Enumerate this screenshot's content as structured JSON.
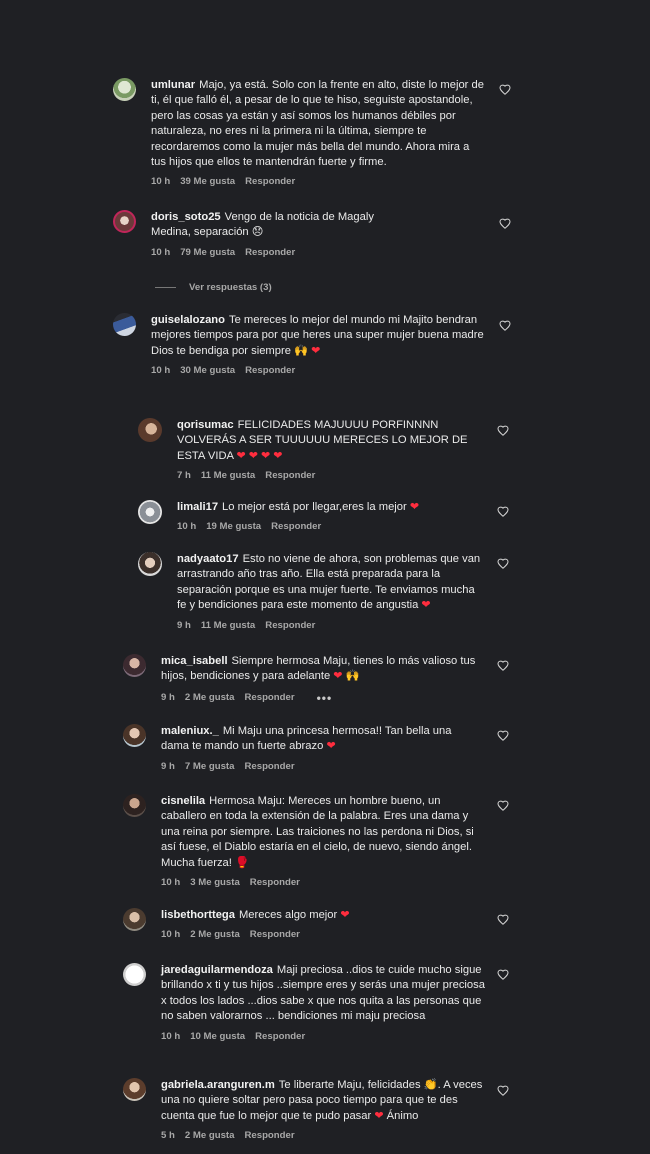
{
  "colors": {
    "background": "#1f2024",
    "text": "#eaeaea",
    "meta": "#a8a8a8",
    "heart": "#ff2d3e"
  },
  "comments": [
    {
      "username": "umlunar",
      "text": "Majo, ya está. Solo con la frente en alto, diste lo mejor de ti, él que falló él, a pesar de lo que te hiso, seguiste apostandole, pero las cosas ya están y así somos los humanos débiles por naturaleza, no eres ni la primera ni la última, siempre te recordaremos como la mujer más bella del mundo. Ahora mira a tus hijos que ellos te mantendrán fuerte y firme.",
      "time": "10 h",
      "likes": "39 Me gusta",
      "reply": "Responder"
    },
    {
      "username": "doris_soto25",
      "text": "Vengo de la noticia de Magaly Medina, separación 😞",
      "time": "10 h",
      "likes": "79 Me gusta",
      "reply": "Responder"
    },
    {
      "username": "guiselalozano",
      "text": "Te mereces lo mejor del mundo mi Majito bendran mejores tiempos para por que heres una super mujer buena madre Dios te bendiga por siempre 🙌",
      "heart": "❤",
      "time": "10 h",
      "likes": "30 Me gusta",
      "reply": "Responder"
    },
    {
      "username": "qorisumac",
      "text": "FELICIDADES MAJUUUU PORFINNNN VOLVERÁS A SER TUUUUUU MERECES LO MEJOR DE ESTA VIDA",
      "heart": "❤ ❤ ❤ ❤",
      "time": "7 h",
      "likes": "11 Me gusta",
      "reply": "Responder"
    },
    {
      "username": "limali17",
      "text": "Lo mejor está por llegar,eres la mejor",
      "heart": "❤",
      "time": "10 h",
      "likes": "19 Me gusta",
      "reply": "Responder"
    },
    {
      "username": "nadyaato17",
      "text": "Esto no viene de ahora, son problemas que van arrastrando año tras año. Ella está preparada para la separación porque es una mujer fuerte. Te enviamos mucha fe y bendiciones para este momento de angustia",
      "heart": "❤",
      "time": "9 h",
      "likes": "11 Me gusta",
      "reply": "Responder"
    },
    {
      "username": "mica_isabell",
      "text": "Siempre hermosa Maju, tienes lo más valioso tus hijos, bendiciones y para adelante",
      "heart": "❤",
      "tail": "🙌",
      "time": "9 h",
      "likes": "2 Me gusta",
      "reply": "Responder",
      "more": "•••"
    },
    {
      "username": "maleniux._",
      "text": "Mi Maju una princesa hermosa!! Tan bella una dama te mando un fuerte abrazo",
      "heart": "❤",
      "time": "9 h",
      "likes": "7 Me gusta",
      "reply": "Responder"
    },
    {
      "username": "cisnelila",
      "text": "Hermosa Maju: Mereces un hombre bueno, un caballero en toda la extensión de la palabra. Eres una dama y una reina por siempre. Las traiciones no las perdona ni Dios, si así fuese, el Diablo estaría en el cielo, de nuevo, siendo ángel. Mucha fuerza! 🥊",
      "time": "10 h",
      "likes": "3 Me gusta",
      "reply": "Responder"
    },
    {
      "username": "lisbethorttega",
      "text": "Mereces algo mejor",
      "heart": "❤",
      "time": "10 h",
      "likes": "2 Me gusta",
      "reply": "Responder"
    },
    {
      "username": "jaredaguilarmendoza",
      "text": "Maji preciosa ..dios te cuide mucho sigue brillando x ti y tus hijos ..siempre eres y serás una mujer preciosa x todos los lados ...dios sabe x que nos quita a las personas que no saben valorarnos ... bendiciones mi maju preciosa",
      "time": "10 h",
      "likes": "10 Me gusta",
      "reply": "Responder"
    },
    {
      "username": "gabriela.aranguren.m",
      "text": "Te liberarte Maju, felicidades 👏. A veces una no quiere soltar pero pasa poco tiempo para que te des cuenta que fue lo mejor que te pudo pasar",
      "heart": "❤",
      "tail": "Ánimo",
      "time": "5 h",
      "likes": "2 Me gusta",
      "reply": "Responder"
    }
  ],
  "view_replies": "Ver respuestas (3)",
  "icons": {
    "like": "heart-outline-icon",
    "avatar": "avatar"
  }
}
